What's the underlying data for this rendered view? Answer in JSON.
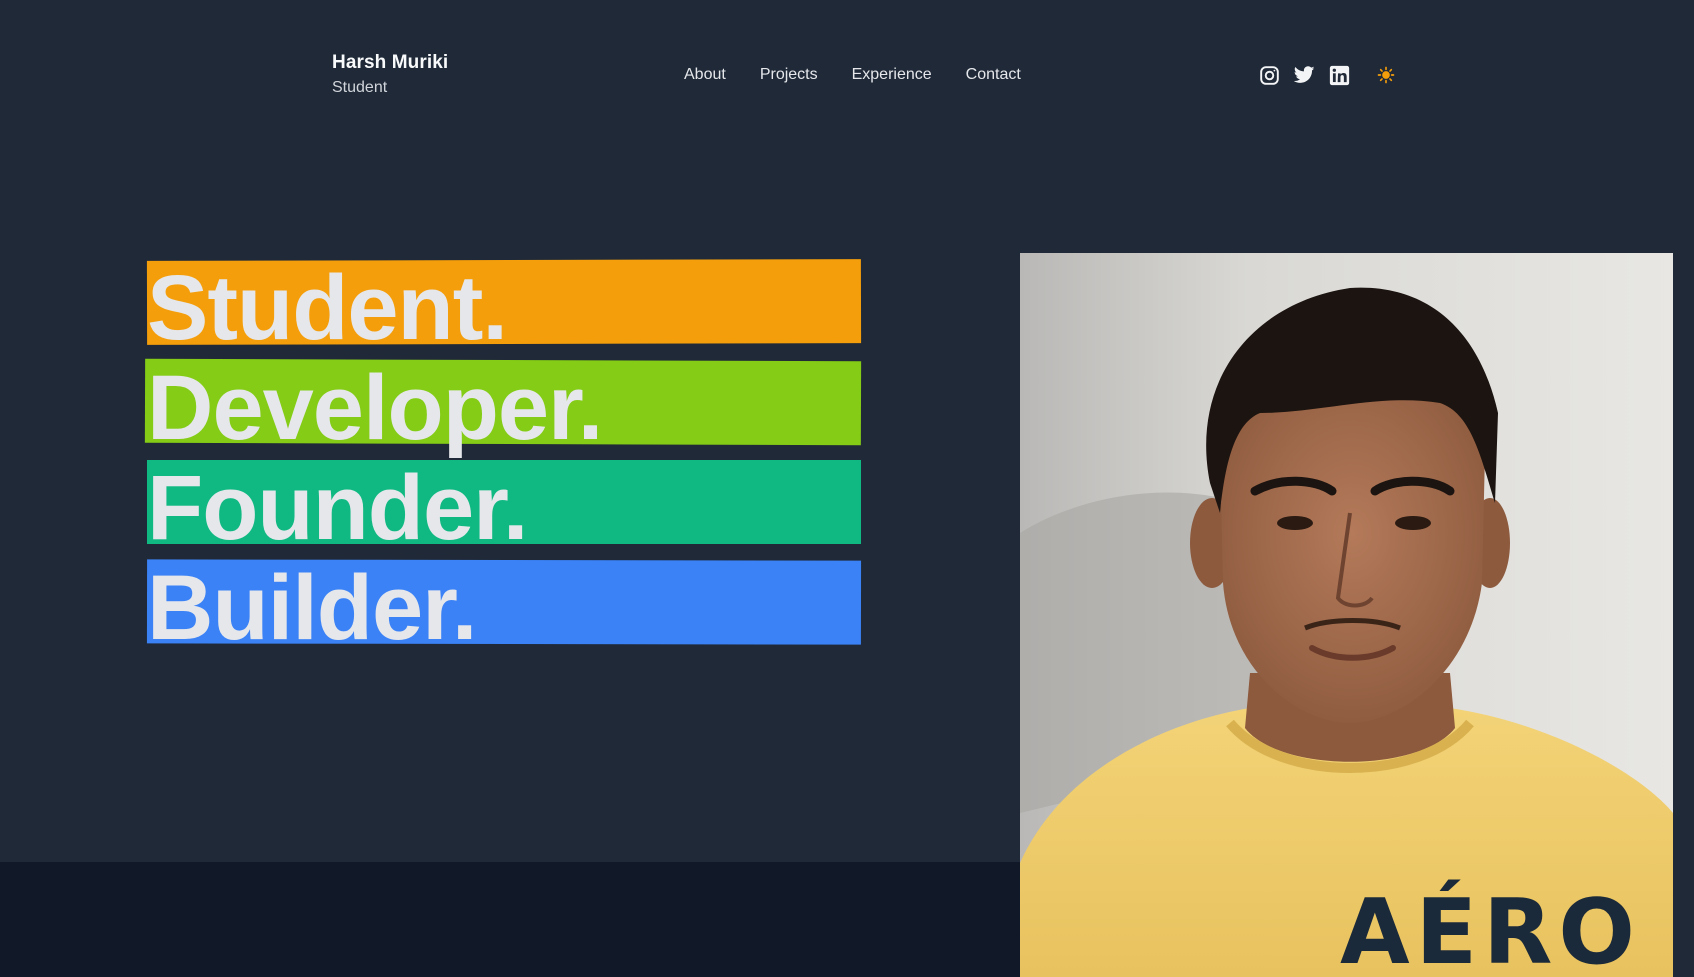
{
  "header": {
    "name": "Harsh Muriki",
    "role": "Student",
    "nav": [
      "About",
      "Projects",
      "Experience",
      "Contact"
    ],
    "social_icons": [
      "instagram-icon",
      "twitter-icon",
      "linkedin-icon"
    ],
    "theme_icon": "sun-icon"
  },
  "hero": {
    "lines": [
      {
        "text": "Student.",
        "color": "#f59e0b"
      },
      {
        "text": "Developer.",
        "color": "#84cc16"
      },
      {
        "text": "Founder.",
        "color": "#10b981"
      },
      {
        "text": "Builder.",
        "color": "#3b82f6"
      }
    ]
  },
  "colors": {
    "background": "#1f2937",
    "footer_band": "#111827",
    "theme_icon": "#f59e0b"
  }
}
